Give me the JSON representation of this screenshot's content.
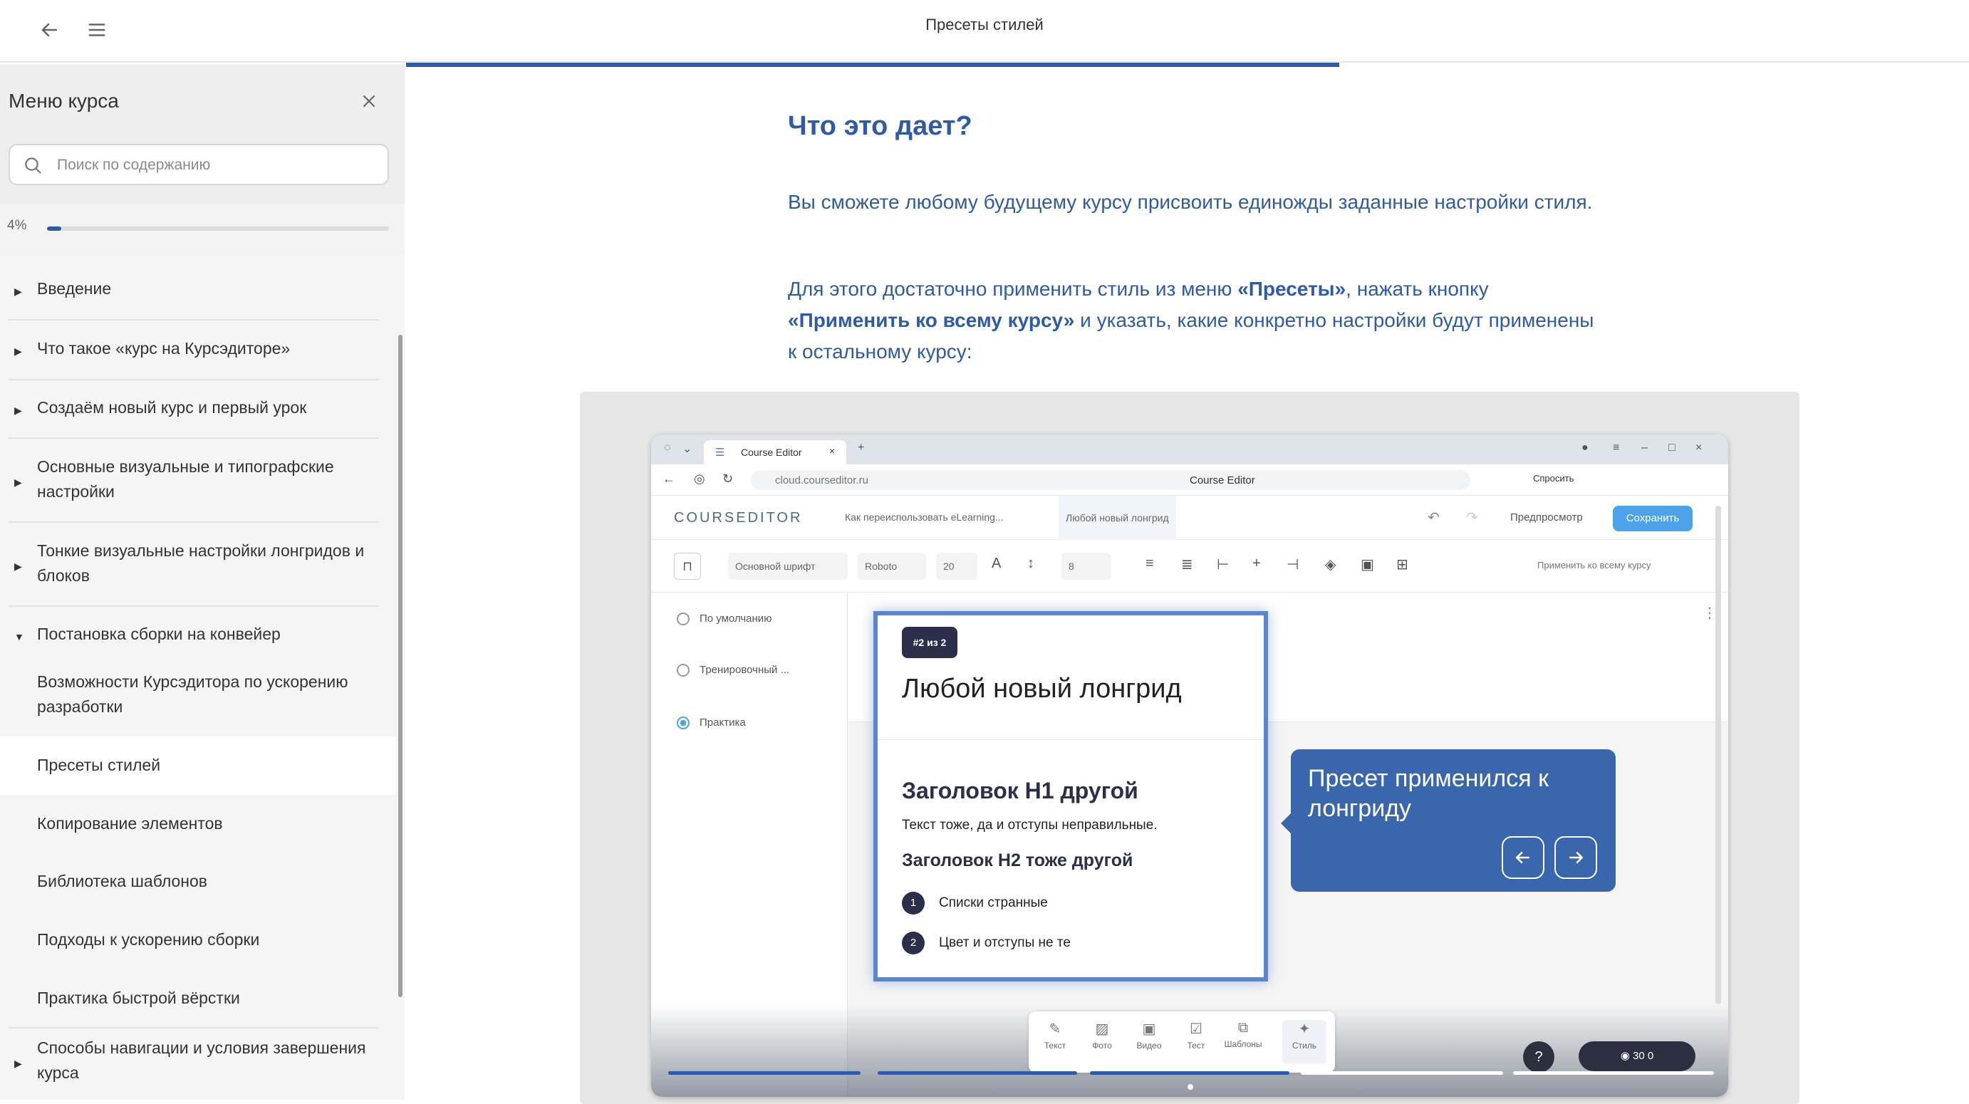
{
  "topbar": {
    "title": "Пресеты стилей"
  },
  "sidebar": {
    "title": "Меню курса",
    "search_placeholder": "Поиск по содержанию",
    "progress_pct": "4%",
    "progress_value": 0.04,
    "items": [
      {
        "label": "Введение",
        "state": "collapsed"
      },
      {
        "label": "Что такое «курс на Курсэдиторе»",
        "state": "collapsed"
      },
      {
        "label": "Создаём новый курс и первый урок",
        "state": "collapsed"
      },
      {
        "label": "Основные визуальные и типографские настройки",
        "state": "collapsed"
      },
      {
        "label": "Тонкие визуальные настройки лонгридов и блоков",
        "state": "collapsed"
      },
      {
        "label": "Постановка сборки на конвейер",
        "state": "expanded"
      }
    ],
    "subitems": [
      {
        "label": "Возможности Курсэдитора по ускорению разработки"
      },
      {
        "label": "Пресеты стилей",
        "active": true
      },
      {
        "label": "Копирование элементов"
      },
      {
        "label": "Библиотека шаблонов"
      },
      {
        "label": "Подходы к ускорению сборки"
      },
      {
        "label": "Практика быстрой вёрстки"
      }
    ],
    "last_item": {
      "label": "Способы навигации и условия завершения курса"
    }
  },
  "content": {
    "heading": "Что это дает?",
    "para1": "Вы сможете любому будущему курсу присвоить единожды заданные настройки стиля.",
    "para2_a": "Для этого достаточно применить стиль из меню ",
    "para2_b": "«Пресеты»",
    "para2_c": ", нажать кнопку ",
    "para2_d": "«Применить ко всему курсу»",
    "para2_e": " и указать, какие конкретно настройки будут применены к остальному курсу:"
  },
  "screenshot": {
    "tab_title": "Course Editor",
    "url": "cloud.courseditor.ru",
    "page_title": "Course Editor",
    "ask_label": "Спросить",
    "logo": "COURSEDITOR",
    "crumb1": "Как переиспользовать eLearning...",
    "crumb2": "Любой новый лонгрид",
    "preview": "Предпросмотр",
    "save": "Сохранить",
    "font_sel": "Основной шрифт",
    "font_name": "Roboto",
    "font_size": "20",
    "line_val": "8",
    "apply_all": "Применить ко всему курсу",
    "presets": [
      {
        "label": "По умолчанию",
        "selected": false
      },
      {
        "label": "Тренировочный ...",
        "selected": false
      },
      {
        "label": "Практика",
        "selected": true
      }
    ],
    "badge": "#2 из 2",
    "card_title": "Любой новый лонгрид",
    "card_h1": "Заголовок H1 другой",
    "card_text": "Текст тоже, да и отступы неправильные.",
    "card_h2": "Заголовок H2 тоже другой",
    "list": [
      {
        "num": "1",
        "text": "Списки странные"
      },
      {
        "num": "2",
        "text": "Цвет и отступы не те"
      }
    ],
    "tools": [
      {
        "label": "Текст",
        "icon": "pencil-icon"
      },
      {
        "label": "Фото",
        "icon": "image-icon"
      },
      {
        "label": "Видео",
        "icon": "video-icon"
      },
      {
        "label": "Тест",
        "icon": "checkbox-icon"
      },
      {
        "label": "Шаблоны",
        "icon": "templates-icon"
      },
      {
        "label": "Стиль",
        "icon": "magic-wand-icon"
      }
    ],
    "stats": "30 0",
    "help": "?"
  },
  "tooltip": {
    "text": "Пресет применился к лонгриду"
  },
  "colors": {
    "accent": "#2f5ba6",
    "tooltip": "#3a66ae",
    "save": "#4da3ea"
  }
}
